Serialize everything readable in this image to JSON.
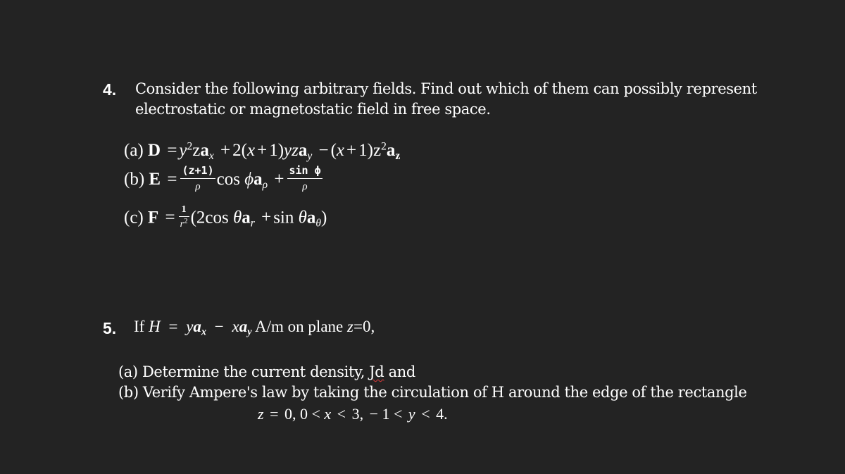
{
  "q4": {
    "number": "4.",
    "line1": "Consider the following arbitrary fields. Find out which of them can possibly represent",
    "line2": "electrostatic or magnetostatic field in free space.",
    "a": {
      "label": "(a)",
      "field": "D",
      "eq": "=",
      "t1_base": "y",
      "t1_exp": "2",
      "t1_rest": "z",
      "unit": "a",
      "sub_x": "x",
      "plus": "+",
      "t2_coef": "2(",
      "t2_var": "x",
      "t2_plus": "+",
      "t2_one": "1)",
      "t2_rest": "yz",
      "sub_y": "y",
      "minus": "−",
      "t3_open": "(",
      "t3_var": "x",
      "t3_plus": "+",
      "t3_one": "1)",
      "t3_z": "z",
      "t3_exp": "2",
      "sub_z": "z"
    },
    "b": {
      "label": "(b)",
      "field": "E",
      "eq": "=",
      "frac1_num": "(z+1)",
      "frac1_den": "ρ",
      "cos": "cos",
      "phi": "ϕ",
      "unit": "a",
      "sub_rho": "ρ",
      "plus": "+",
      "frac2_num": "sin ϕ",
      "frac2_den": "ρ"
    },
    "c": {
      "label": "(c)",
      "field": "F",
      "eq": "=",
      "frac_num": "1",
      "frac_den_base": "r",
      "frac_den_exp": "2",
      "open": "(2cos",
      "theta1": "θ",
      "unit": "a",
      "sub_r": "r",
      "plus": "+",
      "sin": "sin",
      "theta2": "θ",
      "sub_theta": "θ",
      "close": ")"
    }
  },
  "q5": {
    "number": "5.",
    "if": "If",
    "H": "H",
    "eq": "=",
    "y": "y",
    "unit": "a",
    "sub_x": "x",
    "minus": "−",
    "x": "x",
    "sub_y": "y",
    "tail": "A/m on plane",
    "z": "z",
    "eq2": "=",
    "zero": "0,",
    "a_text": "(a) Determine the current density,",
    "a_symbol": "Jd",
    "a_and": "and",
    "b_text": "(b) Verify Ampere's law by taking the circulation of H around the edge of the rectangle",
    "cond": {
      "z": "z",
      "eq": "=",
      "p1": "0, 0 <",
      "x": "x",
      "p2": "<",
      "p3": "3,",
      "p4": "− 1 <",
      "y": "y",
      "p5": "<",
      "p6": "4."
    }
  }
}
